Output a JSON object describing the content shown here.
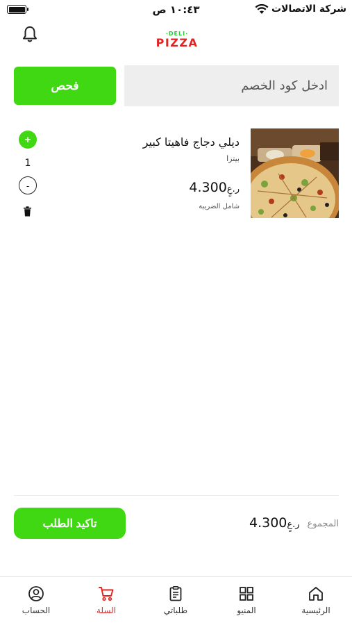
{
  "status_bar": {
    "time": "١٠:٤٣ ص",
    "carrier": "شركة الاتصالات"
  },
  "header": {
    "logo_top": "·DELI·",
    "logo_bottom": "PIZZA"
  },
  "coupon": {
    "placeholder": "ادخل كود الخصم",
    "button_label": "فحص"
  },
  "cart": {
    "items": [
      {
        "name": "ديلي دجاج فاهيتا كبير",
        "category": "بيتزا",
        "price": "4.300",
        "currency": "ر.عٍ",
        "tax_note": "شامل الضريبة",
        "quantity": "1",
        "plus_label": "+",
        "minus_label": "-"
      }
    ]
  },
  "summary": {
    "total_label": "المجموع",
    "total_value": "4.300",
    "currency": "ر.عٍ",
    "confirm_label": "تاكيد الطلب"
  },
  "tabbar": {
    "tabs": [
      {
        "label": "الرئيسية",
        "icon": "home-icon",
        "active": false
      },
      {
        "label": "المنيو",
        "icon": "grid-icon",
        "active": false
      },
      {
        "label": "طلباتي",
        "icon": "clipboard-icon",
        "active": false
      },
      {
        "label": "السلة",
        "icon": "cart-icon",
        "active": true
      },
      {
        "label": "الحساب",
        "icon": "user-icon",
        "active": false
      }
    ]
  },
  "colors": {
    "accent_green": "#3fd812",
    "active_red": "#e52222",
    "input_bg": "#eeeeef"
  }
}
